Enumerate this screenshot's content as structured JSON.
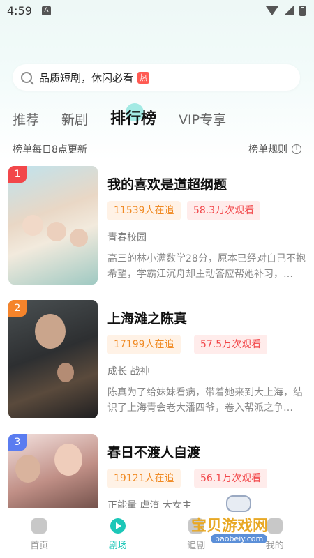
{
  "status_bar": {
    "time": "4:59",
    "notif": "A"
  },
  "search": {
    "text": "品质短剧，休闲必看",
    "badge": "热"
  },
  "tabs": [
    {
      "label": "推荐"
    },
    {
      "label": "新剧"
    },
    {
      "label": "排行榜"
    },
    {
      "label": "VIP专享"
    }
  ],
  "rank_header": {
    "update_text": "榜单每日8点更新",
    "rules_label": "榜单规则"
  },
  "dramas": [
    {
      "rank": "1",
      "title": "我的喜欢是道超纲题",
      "followers": "11539人在追",
      "views": "58.3万次观看",
      "genre": "青春校园",
      "desc": "高三的林小满数学28分，原本已经对自己不抱希望，学霸江沉舟却主动答应帮她补习，…"
    },
    {
      "rank": "2",
      "title": "上海滩之陈真",
      "followers": "17199人在追",
      "views": "57.5万次观看",
      "genre": "成长 战神",
      "desc": "陈真为了给妹妹看病，带着她来到大上海，结识了上海青会老大潘四爷，卷入帮派之争…"
    },
    {
      "rank": "3",
      "title": "春日不渡人自渡",
      "followers": "19121人在追",
      "views": "56.1万次观看",
      "genre": "正能量 虐渣 大女主",
      "desc": ""
    }
  ],
  "nav": [
    {
      "label": "首页"
    },
    {
      "label": "剧场"
    },
    {
      "label": "追剧"
    },
    {
      "label": "我的"
    }
  ],
  "watermark": {
    "text": "宝贝游戏网",
    "url": "baobeiy.com"
  },
  "colors": {
    "accent": "#1cc7b8",
    "follow_text": "#f08a23",
    "views_text": "#f2474a",
    "rank1": "#f2474a",
    "rank2": "#f5842b",
    "rank3": "#5a7cf0"
  }
}
